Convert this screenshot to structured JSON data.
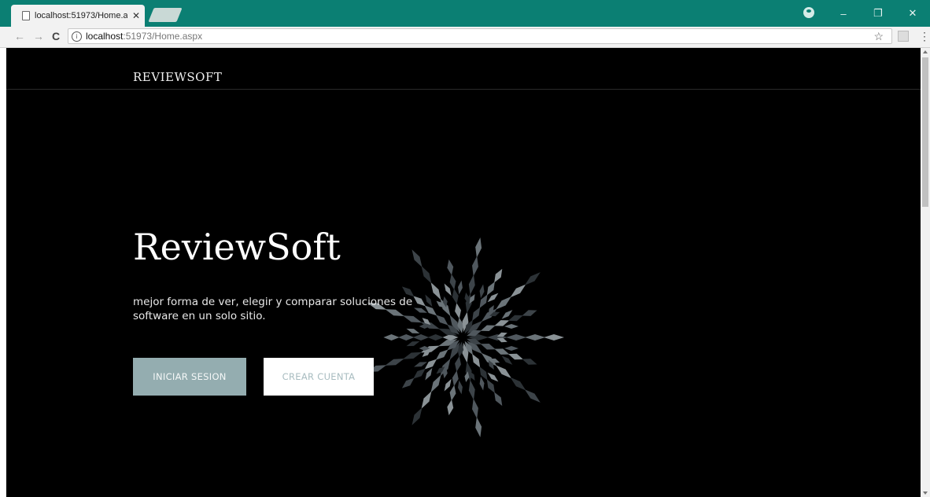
{
  "browser": {
    "tab_title": "localhost:51973/Home.a:",
    "tab_close": "✕",
    "url_host": "localhost",
    "url_path": ":51973/Home.aspx",
    "window_controls": {
      "minimize": "–",
      "restore": "❐",
      "close": "✕"
    },
    "nav": {
      "back": "←",
      "forward": "→",
      "reload": "C"
    },
    "icons": [
      "page-icon",
      "info-icon",
      "star-icon",
      "profile-icon",
      "pdf-extension-icon",
      "menu-icon"
    ]
  },
  "site": {
    "logo": "REVIEWSOFT",
    "hero_title": "ReviewSoft",
    "hero_subtitle": "mejor forma de ver, elegir y comparar soluciones de software en un solo sitio.",
    "buttons": {
      "login": "INICIAR SESION",
      "signup": "CREAR CUENTA"
    }
  },
  "colors": {
    "titlebar": "#0b7f73",
    "page_background": "#000000",
    "login_button": "#94adb0",
    "signup_button": "#ffffff",
    "signup_text": "#a8bcc0"
  }
}
